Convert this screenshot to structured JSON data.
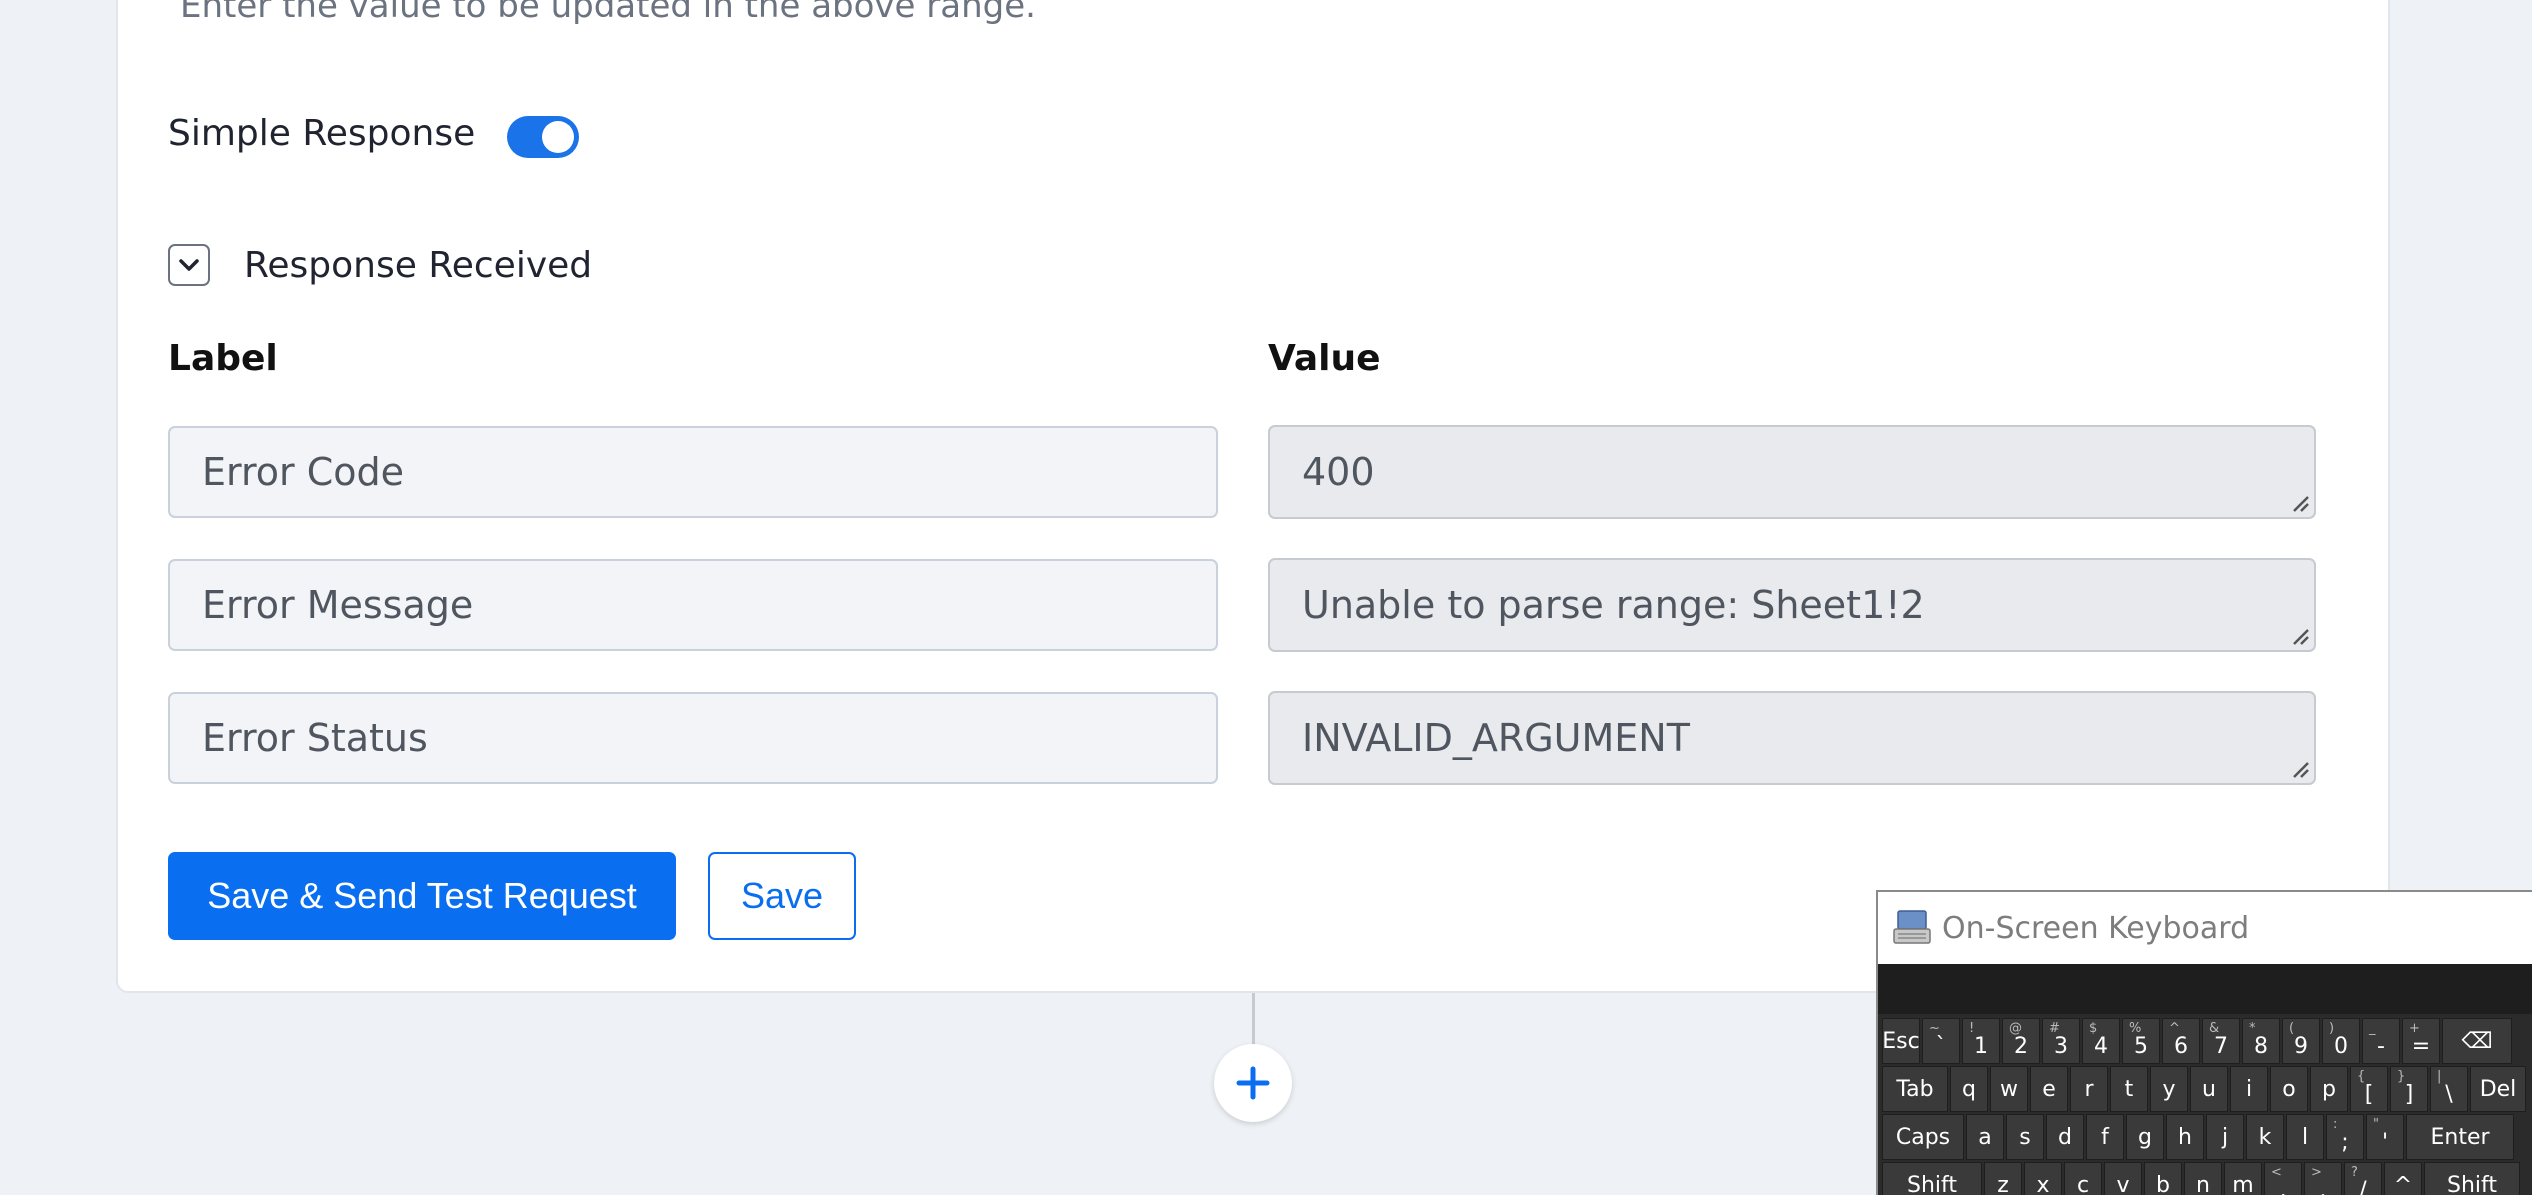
{
  "form": {
    "hint_text": "Enter the value to be updated in the above range.",
    "simple_response_label": "Simple Response",
    "simple_response_enabled": true,
    "response_section_label": "Response Received",
    "label_column_header": "Label",
    "value_column_header": "Value",
    "rows": [
      {
        "label": "Error Code",
        "value": "400"
      },
      {
        "label": "Error Message",
        "value": "Unable to parse range: Sheet1!2"
      },
      {
        "label": "Error Status",
        "value": "INVALID_ARGUMENT"
      }
    ],
    "primary_button_label": "Save & Send Test Request",
    "secondary_button_label": "Save"
  },
  "accent_color": "#0a6ef0",
  "icons": {
    "add_step": "plus-icon",
    "collapse": "chevron-down-icon"
  },
  "osk": {
    "title": "On-Screen Keyboard",
    "row1": [
      {
        "b": "Esc",
        "t": ""
      },
      {
        "b": "`",
        "t": "~"
      },
      {
        "b": "1",
        "t": "!"
      },
      {
        "b": "2",
        "t": "@"
      },
      {
        "b": "3",
        "t": "#"
      },
      {
        "b": "4",
        "t": "$"
      },
      {
        "b": "5",
        "t": "%"
      },
      {
        "b": "6",
        "t": "^"
      },
      {
        "b": "7",
        "t": "&"
      },
      {
        "b": "8",
        "t": "*"
      },
      {
        "b": "9",
        "t": "("
      },
      {
        "b": "0",
        "t": ")"
      },
      {
        "b": "-",
        "t": "_"
      },
      {
        "b": "=",
        "t": "+"
      },
      {
        "b": "⌫",
        "t": ""
      }
    ],
    "row2": [
      {
        "b": "Tab",
        "t": ""
      },
      {
        "b": "q",
        "t": ""
      },
      {
        "b": "w",
        "t": ""
      },
      {
        "b": "e",
        "t": ""
      },
      {
        "b": "r",
        "t": ""
      },
      {
        "b": "t",
        "t": ""
      },
      {
        "b": "y",
        "t": ""
      },
      {
        "b": "u",
        "t": ""
      },
      {
        "b": "i",
        "t": ""
      },
      {
        "b": "o",
        "t": ""
      },
      {
        "b": "p",
        "t": ""
      },
      {
        "b": "[",
        "t": "{"
      },
      {
        "b": "]",
        "t": "}"
      },
      {
        "b": "\\",
        "t": "|"
      },
      {
        "b": "Del",
        "t": ""
      }
    ],
    "row3": [
      {
        "b": "Caps",
        "t": ""
      },
      {
        "b": "a",
        "t": ""
      },
      {
        "b": "s",
        "t": ""
      },
      {
        "b": "d",
        "t": ""
      },
      {
        "b": "f",
        "t": ""
      },
      {
        "b": "g",
        "t": ""
      },
      {
        "b": "h",
        "t": ""
      },
      {
        "b": "j",
        "t": ""
      },
      {
        "b": "k",
        "t": ""
      },
      {
        "b": "l",
        "t": ""
      },
      {
        "b": ";",
        "t": ":"
      },
      {
        "b": "'",
        "t": "\""
      },
      {
        "b": "Enter",
        "t": ""
      }
    ],
    "row4": [
      {
        "b": "Shift",
        "t": ""
      },
      {
        "b": "z",
        "t": ""
      },
      {
        "b": "x",
        "t": ""
      },
      {
        "b": "c",
        "t": ""
      },
      {
        "b": "v",
        "t": ""
      },
      {
        "b": "b",
        "t": ""
      },
      {
        "b": "n",
        "t": ""
      },
      {
        "b": "m",
        "t": ""
      },
      {
        "b": ",",
        "t": "<"
      },
      {
        "b": ".",
        "t": ">"
      },
      {
        "b": "/",
        "t": "?"
      },
      {
        "b": "^",
        "t": ""
      },
      {
        "b": "Shift",
        "t": ""
      }
    ]
  }
}
